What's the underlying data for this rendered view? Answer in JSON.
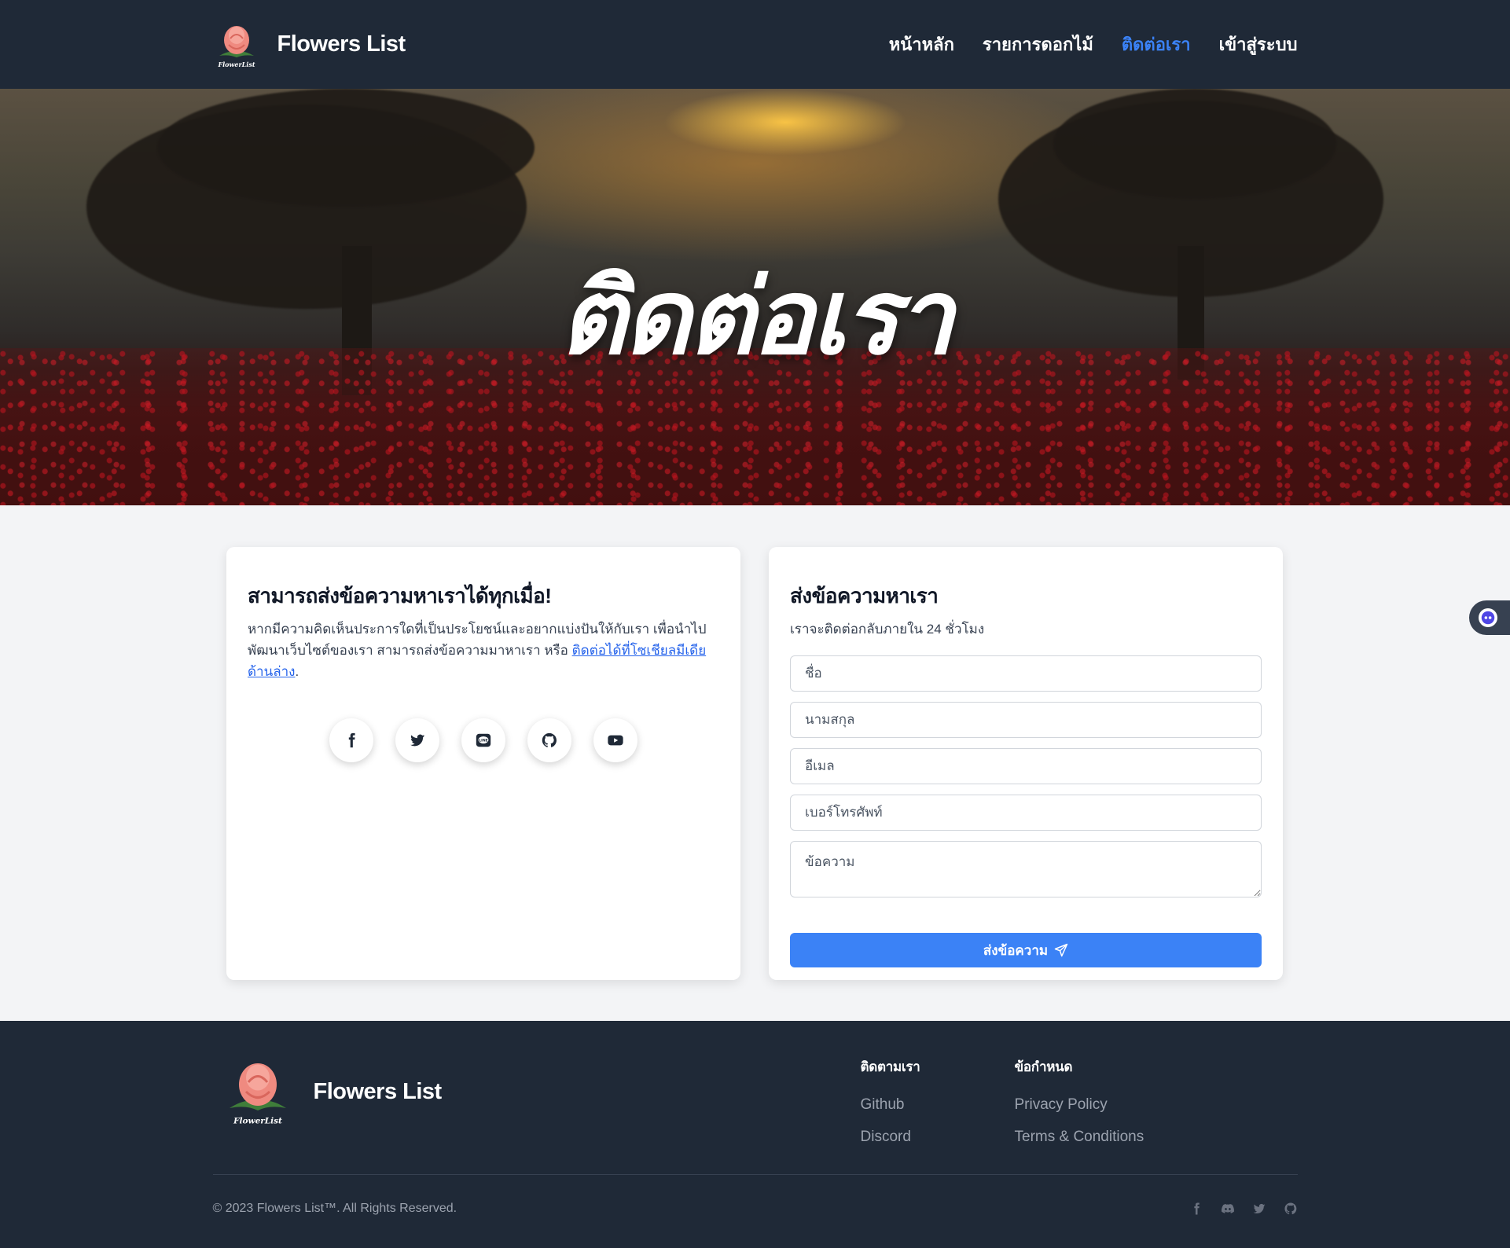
{
  "brand": {
    "name": "Flowers List",
    "logo_caption": "FlowerList"
  },
  "nav": {
    "items": [
      {
        "label": "หน้าหลัก",
        "active": false
      },
      {
        "label": "รายการดอกไม้",
        "active": false
      },
      {
        "label": "ติดต่อเรา",
        "active": true
      },
      {
        "label": "เข้าสู่ระบบ",
        "active": false
      }
    ]
  },
  "hero": {
    "title": "ติดต่อเรา"
  },
  "left_card": {
    "title": "สามารถส่งข้อความหาเราได้ทุกเมื่อ!",
    "description": "หากมีความคิดเห็นประการใดที่เป็นประโยชน์และอยากแบ่งปันให้กับเรา เพื่อนำไปพัฒนาเว็บไซต์ของเรา สามารถส่งข้อความมาหาเรา หรือ ",
    "link_text": "ติดต่อได้ที่โซเชียลมีเดียด้านล่าง",
    "trailing": ".",
    "socials": [
      "facebook-icon",
      "twitter-icon",
      "line-icon",
      "github-icon",
      "youtube-icon"
    ]
  },
  "contact_form": {
    "title": "ส่งข้อความหาเรา",
    "subtitle": "เราจะติดต่อกลับภายใน 24 ชั่วโมง",
    "first_name_placeholder": "ชื่อ",
    "last_name_placeholder": "นามสกุล",
    "email_placeholder": "อีเมล",
    "phone_placeholder": "เบอร์โทรศัพท์",
    "message_placeholder": "ข้อความ",
    "submit_label": "ส่งข้อความ"
  },
  "footer": {
    "brand_name": "Flowers List",
    "follow": {
      "heading": "ติดตามเรา",
      "links": [
        "Github",
        "Discord"
      ]
    },
    "terms": {
      "heading": "ข้อกำหนด",
      "links": [
        "Privacy Policy",
        "Terms & Conditions"
      ]
    },
    "copyright": "© 2023 Flowers List™. All Rights Reserved.",
    "socials": [
      "facebook-icon",
      "discord-icon",
      "twitter-icon",
      "github-icon"
    ]
  },
  "colors": {
    "navbar_bg": "#1f2937",
    "accent": "#3b82f6",
    "page_bg": "#f3f4f6"
  }
}
